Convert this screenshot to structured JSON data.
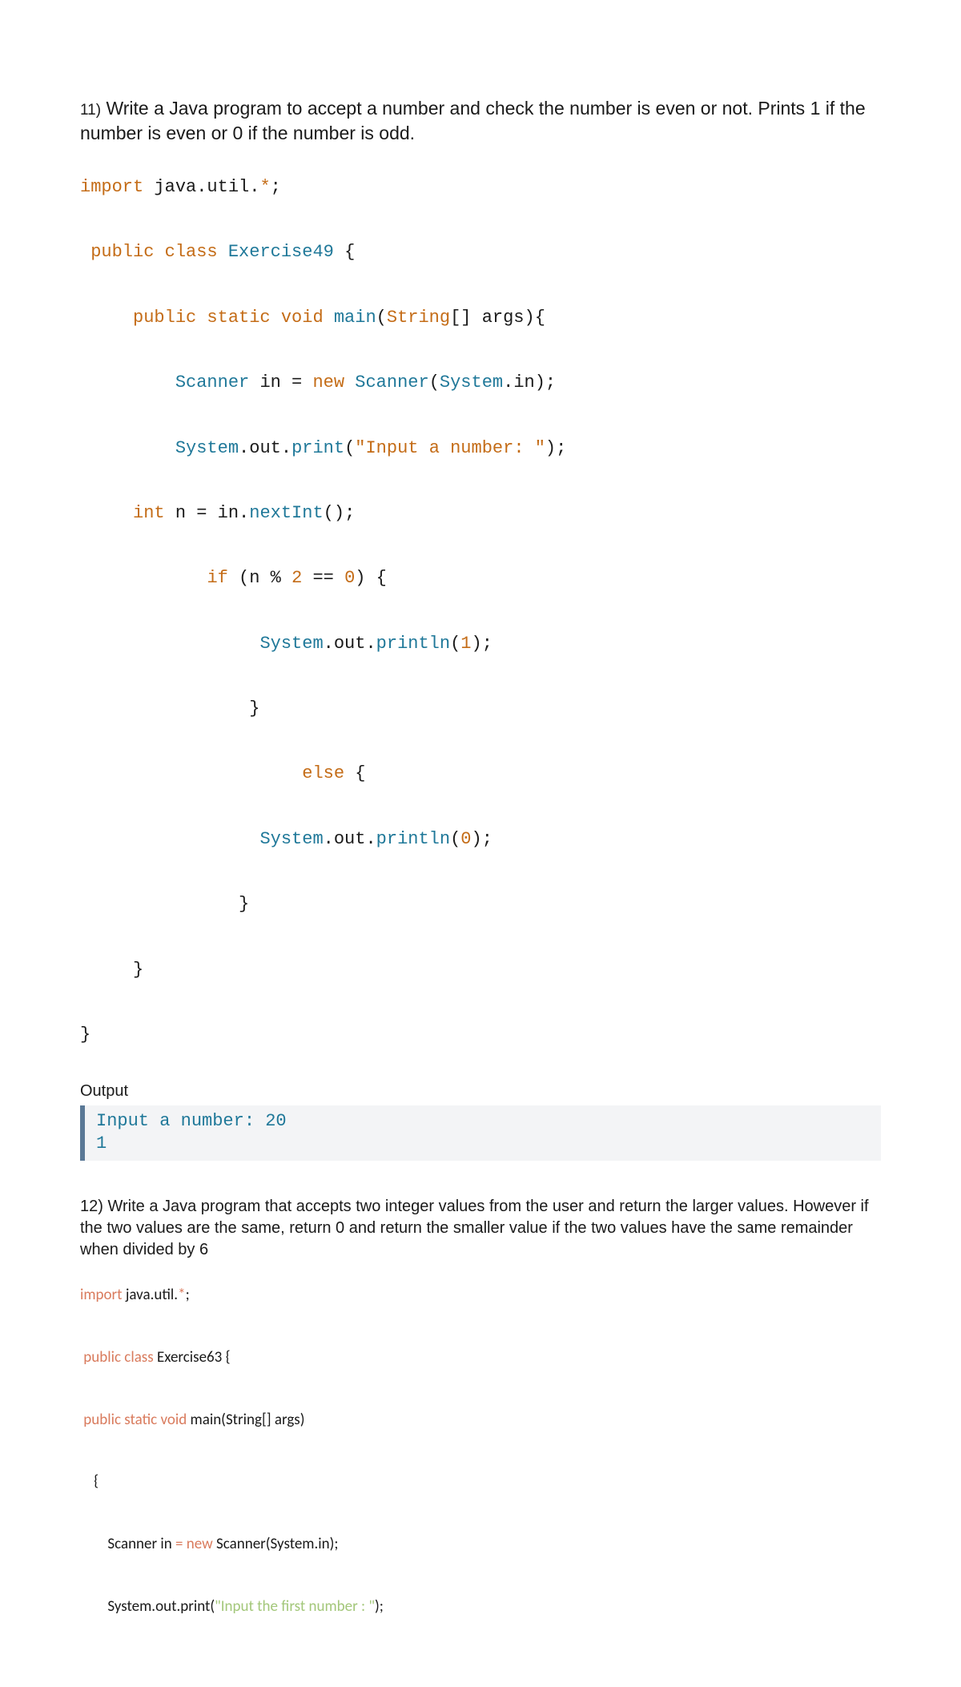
{
  "q11": {
    "number": "11)",
    "text": "Write a Java program to accept a number and check the number is even or not. Prints 1 if the number is even or 0 if the number is odd."
  },
  "code11": {
    "l1_import": "import",
    "l1_pkg": " java.util.",
    "l1_star": "*",
    "l1_semic": ";",
    "l2_public": " public class",
    "l2_class": " Exercise49",
    "l2_brace": " {",
    "l3_mods": "     public static void",
    "l3_main": " main",
    "l3_par": "(",
    "l3_str": "String",
    "l3_arg": "[] args){",
    "l4_pad": "         ",
    "l4_scan": "Scanner",
    "l4_in": " in",
    "l4_eq": " = ",
    "l4_new": "new",
    "l4_scan2": " Scanner",
    "l4_par": "(",
    "l4_sys": "System",
    "l4_in2": ".in",
    "l4_end": ");",
    "l5_pad": "         ",
    "l5_sys": "System",
    "l5_out": ".out.",
    "l5_print": "print",
    "l5_par": "(",
    "l5_str": "\"Input a number: \"",
    "l5_end": ");",
    "l6_pad": "     ",
    "l6_int": "int",
    "l6_n": " n",
    "l6_eq": " = ",
    "l6_in": "in",
    "l6_dot": ".",
    "l6_next": "nextInt",
    "l6_end": "();",
    "l7_pad": "            ",
    "l7_if": "if",
    "l7_par": " (",
    "l7_n": "n",
    "l7_mod": " % ",
    "l7_two": "2",
    "l7_eq": " == ",
    "l7_zero": "0",
    "l7_end": ") {",
    "l8_pad": "                 ",
    "l8_sys": "System",
    "l8_out": ".out.",
    "l8_println": "println",
    "l8_par": "(",
    "l8_one": "1",
    "l8_end": ");",
    "l9": "                }",
    "l10_pad": "                     ",
    "l10_else": "else",
    "l10_brace": " {",
    "l11_pad": "                 ",
    "l11_sys": "System",
    "l11_out": ".out.",
    "l11_println": "println",
    "l11_par": "(",
    "l11_zero": "0",
    "l11_end": ");",
    "l12": "               }",
    "l13": "     }",
    "l14": "}"
  },
  "output": {
    "label": "Output",
    "line1": "Input a number: 20",
    "line2": "1"
  },
  "q12": {
    "number": "12)",
    "text": " Write a Java program that accepts two integer values from the user and return the larger values. However if the two values are the same, return 0 and return the smaller value if the two values have the same remainder when divided by 6"
  },
  "code12": {
    "l1_import": "import",
    "l1_pkg": " java.util.",
    "l1_star": "*",
    "l1_semic": ";",
    "l2_mods": " public class",
    "l2_class": " Exercise63 {",
    "l3_mods": " public static void",
    "l3_main": " main(String[] args)",
    "l4": "    {",
    "l5_pad": "        Scanner in ",
    "l5_eq": "=",
    "l5_new": " new",
    "l5_rest": " Scanner(System.in);",
    "l6_pad": "        System.out.print(",
    "l6_str": "\"Input the first number : \"",
    "l6_end": ");"
  }
}
